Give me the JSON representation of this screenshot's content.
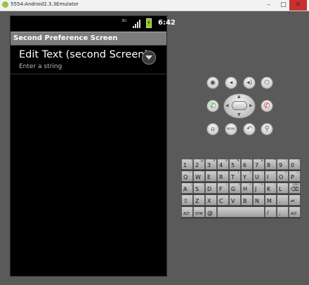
{
  "window": {
    "title": "5554:Android2.3.3Emulator",
    "controls": {
      "minimize": "–",
      "maximize": "□",
      "close": "✕"
    }
  },
  "statusbar": {
    "network": "3G",
    "time": "6:42"
  },
  "screen": {
    "title": "Second Preference Screen",
    "pref_item": {
      "title": "Edit Text (second Screen)",
      "summary": "Enter a string"
    }
  },
  "controls": {
    "row1": [
      {
        "name": "camera",
        "icon": "camera-icon",
        "glyph": "◉"
      },
      {
        "name": "volume-down",
        "icon": "volume-down-icon",
        "glyph": "◂"
      },
      {
        "name": "volume-up",
        "icon": "volume-up-icon",
        "glyph": "◂)"
      },
      {
        "name": "power",
        "icon": "power-icon",
        "glyph": "⏻"
      }
    ],
    "call": {
      "glyph": "✆",
      "color": "#2e9e3a"
    },
    "end_call": {
      "glyph": "✆",
      "color": "#d22a2a"
    },
    "row3": [
      {
        "name": "home",
        "icon": "home-icon",
        "glyph": "⌂"
      },
      {
        "name": "menu",
        "icon": "menu-icon",
        "glyph": "MENU"
      },
      {
        "name": "back",
        "icon": "back-icon",
        "glyph": "↶"
      },
      {
        "name": "search",
        "icon": "search-icon",
        "glyph": "⚲"
      }
    ]
  },
  "keyboard": {
    "row1": [
      {
        "main": "1",
        "sub": "!"
      },
      {
        "main": "2",
        "sub": "@"
      },
      {
        "main": "3",
        "sub": "#"
      },
      {
        "main": "4",
        "sub": "$"
      },
      {
        "main": "5",
        "sub": "%"
      },
      {
        "main": "6",
        "sub": "^"
      },
      {
        "main": "7",
        "sub": "&"
      },
      {
        "main": "8",
        "sub": "*"
      },
      {
        "main": "9",
        "sub": "("
      },
      {
        "main": "0",
        "sub": ")"
      }
    ],
    "row2": [
      {
        "main": "Q",
        "sub": "~"
      },
      {
        "main": "W",
        "sub": "\""
      },
      {
        "main": "E",
        "sub": "´"
      },
      {
        "main": "R",
        "sub": ""
      },
      {
        "main": "T",
        "sub": "{"
      },
      {
        "main": "Y",
        "sub": "}"
      },
      {
        "main": "U",
        "sub": "-"
      },
      {
        "main": "I",
        "sub": "_"
      },
      {
        "main": "O",
        "sub": "+"
      },
      {
        "main": "P",
        "sub": "="
      }
    ],
    "row3": [
      {
        "main": "A",
        "sub": "\\"
      },
      {
        "main": "S",
        "sub": "\\"
      },
      {
        "main": "D",
        "sub": "´"
      },
      {
        "main": "F",
        "sub": "["
      },
      {
        "main": "G",
        "sub": "]"
      },
      {
        "main": "H",
        "sub": "<"
      },
      {
        "main": "J",
        "sub": ">"
      },
      {
        "main": "K",
        "sub": ";"
      },
      {
        "main": "L",
        "sub": ":"
      },
      {
        "main": "⌫",
        "sub": "DEL"
      }
    ],
    "row4": [
      {
        "main": "⇧",
        "sub": ""
      },
      {
        "main": "Z",
        "sub": ""
      },
      {
        "main": "X",
        "sub": ""
      },
      {
        "main": "C",
        "sub": ""
      },
      {
        "main": "V",
        "sub": ""
      },
      {
        "main": "B",
        "sub": ""
      },
      {
        "main": "N",
        "sub": ""
      },
      {
        "main": "M",
        "sub": ""
      },
      {
        "main": ".",
        "sub": ""
      },
      {
        "main": "↵",
        "sub": ""
      }
    ],
    "row5": {
      "alt_left": "ALT",
      "sym": "SYM",
      "at": "@",
      "space": "",
      "slash": "/",
      "comma": ",",
      "alt_right": "ALT"
    }
  }
}
